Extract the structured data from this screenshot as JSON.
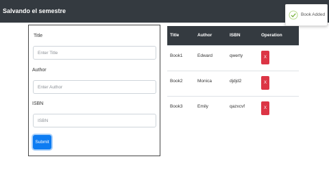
{
  "navbar": {
    "brand": "Salvando el semestre"
  },
  "toast": {
    "message": "Book Added",
    "icon": "check-circle-icon",
    "accent": "#8bc34a"
  },
  "form": {
    "title_label": "Title",
    "title_placeholder": "Enter Title",
    "author_label": "Author",
    "author_placeholder": "Enter Author",
    "isbn_label": "ISBN",
    "isbn_placeholder": "ISBN",
    "submit_label": "Submit"
  },
  "table": {
    "headers": [
      "Title",
      "Author",
      "ISBN",
      "Operation"
    ],
    "rows": [
      {
        "title": "Book1",
        "author": "Edward",
        "isbn": "qwerty",
        "delete_label": "X"
      },
      {
        "title": "Book2",
        "author": "Monica",
        "isbn": "djdjd2",
        "delete_label": "X"
      },
      {
        "title": "Book3",
        "author": "Emily",
        "isbn": "qazxcvf",
        "delete_label": "X"
      }
    ]
  },
  "colors": {
    "navbar": "#343a40",
    "primary": "#0d7cf2",
    "danger": "#dc3545"
  }
}
